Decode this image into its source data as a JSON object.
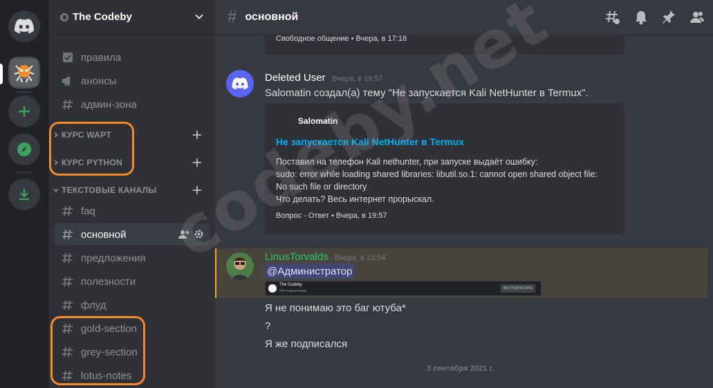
{
  "server": {
    "name": "The Codeby"
  },
  "channels_top": [
    {
      "label": "правила",
      "icon": "rules-icon"
    },
    {
      "label": "анонсы",
      "icon": "announcement-icon"
    },
    {
      "label": "админ-зона",
      "icon": "hash-icon"
    }
  ],
  "categories": [
    {
      "label": "КУРС WAPT",
      "collapsed": true
    },
    {
      "label": "КУРС PYTHON",
      "collapsed": true
    },
    {
      "label": "ТЕКСТОВЫЕ КАНАЛЫ",
      "collapsed": false
    }
  ],
  "text_channels": [
    {
      "label": "faq"
    },
    {
      "label": "основной",
      "active": true
    },
    {
      "label": "предложения"
    },
    {
      "label": "полезности"
    },
    {
      "label": "флуд"
    },
    {
      "label": "gold-section"
    },
    {
      "label": "grey-section"
    },
    {
      "label": "lotus-notes"
    }
  ],
  "topbar": {
    "channel": "основной"
  },
  "messages": {
    "prev_embed_footer": "Свободное общение • Вчера, в 17:18",
    "m1": {
      "author": "Deleted User",
      "time": "Вчера, в 19:57",
      "text": "Salomatin создал(а) тему \"Не запускается Kali NetHunter в Termux\".",
      "embed": {
        "author": "Salomatin",
        "title": "Не запускается Kali NetHunter в Termux",
        "lines": [
          "Поставил на телефон Kali nethunter, при запуске выдаёт ошибку:",
          "sudo: error while loading shared libraries: libutil.so.1: cannot open shared object file:",
          "No such file or directory",
          "Что делать? Весь интернет прорыскал."
        ],
        "footer": "Вопрос - Ответ • Вчера, в 19:57"
      }
    },
    "m2": {
      "author": "LinusTorvalds",
      "time": "Вчера, в 23:54",
      "mention": "@Администратор",
      "screenshot": {
        "name": "The Codeby",
        "sub": "### подписчиков",
        "button": "ВЫ ПОДПИСАНЫ"
      },
      "lines": [
        "Я не понимаю это баг ютуба*",
        "?",
        "Я же подписался"
      ]
    },
    "date_divider": "3 сентября 2021 г."
  },
  "watermark": "codeby.net",
  "colors": {
    "accent_orange": "#f58a2a",
    "link": "#00aff4",
    "blurple": "#5865f2",
    "green": "#3ba55d",
    "mention_bg": "#49443c"
  }
}
